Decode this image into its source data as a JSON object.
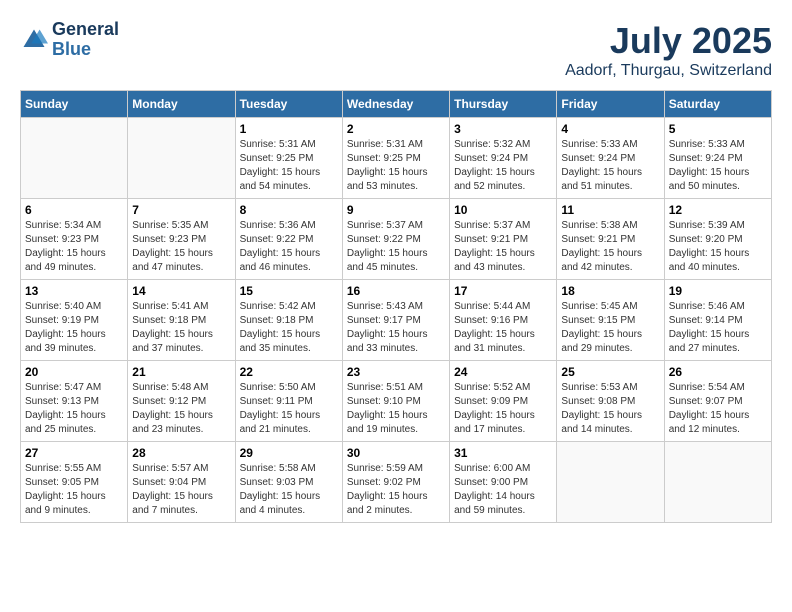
{
  "header": {
    "logo_line1": "General",
    "logo_line2": "Blue",
    "title": "July 2025",
    "subtitle": "Aadorf, Thurgau, Switzerland"
  },
  "weekdays": [
    "Sunday",
    "Monday",
    "Tuesday",
    "Wednesday",
    "Thursday",
    "Friday",
    "Saturday"
  ],
  "weeks": [
    [
      {
        "day": "",
        "info": ""
      },
      {
        "day": "",
        "info": ""
      },
      {
        "day": "1",
        "info": "Sunrise: 5:31 AM\nSunset: 9:25 PM\nDaylight: 15 hours\nand 54 minutes."
      },
      {
        "day": "2",
        "info": "Sunrise: 5:31 AM\nSunset: 9:25 PM\nDaylight: 15 hours\nand 53 minutes."
      },
      {
        "day": "3",
        "info": "Sunrise: 5:32 AM\nSunset: 9:24 PM\nDaylight: 15 hours\nand 52 minutes."
      },
      {
        "day": "4",
        "info": "Sunrise: 5:33 AM\nSunset: 9:24 PM\nDaylight: 15 hours\nand 51 minutes."
      },
      {
        "day": "5",
        "info": "Sunrise: 5:33 AM\nSunset: 9:24 PM\nDaylight: 15 hours\nand 50 minutes."
      }
    ],
    [
      {
        "day": "6",
        "info": "Sunrise: 5:34 AM\nSunset: 9:23 PM\nDaylight: 15 hours\nand 49 minutes."
      },
      {
        "day": "7",
        "info": "Sunrise: 5:35 AM\nSunset: 9:23 PM\nDaylight: 15 hours\nand 47 minutes."
      },
      {
        "day": "8",
        "info": "Sunrise: 5:36 AM\nSunset: 9:22 PM\nDaylight: 15 hours\nand 46 minutes."
      },
      {
        "day": "9",
        "info": "Sunrise: 5:37 AM\nSunset: 9:22 PM\nDaylight: 15 hours\nand 45 minutes."
      },
      {
        "day": "10",
        "info": "Sunrise: 5:37 AM\nSunset: 9:21 PM\nDaylight: 15 hours\nand 43 minutes."
      },
      {
        "day": "11",
        "info": "Sunrise: 5:38 AM\nSunset: 9:21 PM\nDaylight: 15 hours\nand 42 minutes."
      },
      {
        "day": "12",
        "info": "Sunrise: 5:39 AM\nSunset: 9:20 PM\nDaylight: 15 hours\nand 40 minutes."
      }
    ],
    [
      {
        "day": "13",
        "info": "Sunrise: 5:40 AM\nSunset: 9:19 PM\nDaylight: 15 hours\nand 39 minutes."
      },
      {
        "day": "14",
        "info": "Sunrise: 5:41 AM\nSunset: 9:18 PM\nDaylight: 15 hours\nand 37 minutes."
      },
      {
        "day": "15",
        "info": "Sunrise: 5:42 AM\nSunset: 9:18 PM\nDaylight: 15 hours\nand 35 minutes."
      },
      {
        "day": "16",
        "info": "Sunrise: 5:43 AM\nSunset: 9:17 PM\nDaylight: 15 hours\nand 33 minutes."
      },
      {
        "day": "17",
        "info": "Sunrise: 5:44 AM\nSunset: 9:16 PM\nDaylight: 15 hours\nand 31 minutes."
      },
      {
        "day": "18",
        "info": "Sunrise: 5:45 AM\nSunset: 9:15 PM\nDaylight: 15 hours\nand 29 minutes."
      },
      {
        "day": "19",
        "info": "Sunrise: 5:46 AM\nSunset: 9:14 PM\nDaylight: 15 hours\nand 27 minutes."
      }
    ],
    [
      {
        "day": "20",
        "info": "Sunrise: 5:47 AM\nSunset: 9:13 PM\nDaylight: 15 hours\nand 25 minutes."
      },
      {
        "day": "21",
        "info": "Sunrise: 5:48 AM\nSunset: 9:12 PM\nDaylight: 15 hours\nand 23 minutes."
      },
      {
        "day": "22",
        "info": "Sunrise: 5:50 AM\nSunset: 9:11 PM\nDaylight: 15 hours\nand 21 minutes."
      },
      {
        "day": "23",
        "info": "Sunrise: 5:51 AM\nSunset: 9:10 PM\nDaylight: 15 hours\nand 19 minutes."
      },
      {
        "day": "24",
        "info": "Sunrise: 5:52 AM\nSunset: 9:09 PM\nDaylight: 15 hours\nand 17 minutes."
      },
      {
        "day": "25",
        "info": "Sunrise: 5:53 AM\nSunset: 9:08 PM\nDaylight: 15 hours\nand 14 minutes."
      },
      {
        "day": "26",
        "info": "Sunrise: 5:54 AM\nSunset: 9:07 PM\nDaylight: 15 hours\nand 12 minutes."
      }
    ],
    [
      {
        "day": "27",
        "info": "Sunrise: 5:55 AM\nSunset: 9:05 PM\nDaylight: 15 hours\nand 9 minutes."
      },
      {
        "day": "28",
        "info": "Sunrise: 5:57 AM\nSunset: 9:04 PM\nDaylight: 15 hours\nand 7 minutes."
      },
      {
        "day": "29",
        "info": "Sunrise: 5:58 AM\nSunset: 9:03 PM\nDaylight: 15 hours\nand 4 minutes."
      },
      {
        "day": "30",
        "info": "Sunrise: 5:59 AM\nSunset: 9:02 PM\nDaylight: 15 hours\nand 2 minutes."
      },
      {
        "day": "31",
        "info": "Sunrise: 6:00 AM\nSunset: 9:00 PM\nDaylight: 14 hours\nand 59 minutes."
      },
      {
        "day": "",
        "info": ""
      },
      {
        "day": "",
        "info": ""
      }
    ]
  ]
}
